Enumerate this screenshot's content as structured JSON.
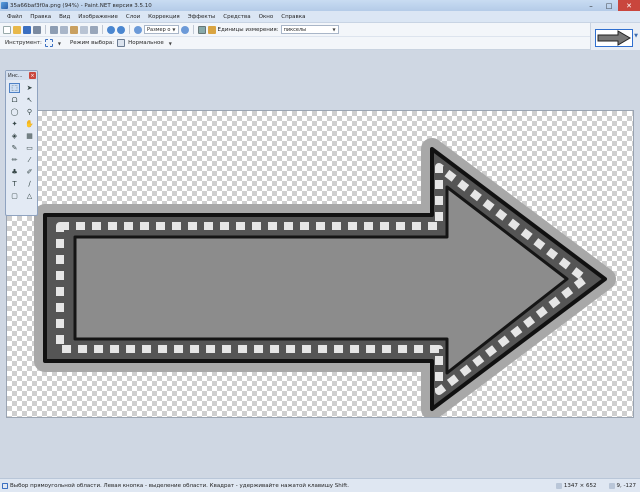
{
  "window": {
    "title": "35a66baf3f0a.png (94%) - Paint.NET версия 3.5.10",
    "minimize": "–",
    "maximize": "□",
    "close": "✕"
  },
  "menu": [
    "Файл",
    "Правка",
    "Вид",
    "Изображение",
    "Слои",
    "Коррекция",
    "Эффекты",
    "Средства",
    "Окно",
    "Справка"
  ],
  "toolbar": {
    "size_dropdown": "Размер о",
    "units_label": "Единицы измерения:",
    "units_value": "пикселы"
  },
  "toolbar2": {
    "instrument_label": "Инструмент:",
    "selection_mode_label": "Режим выбора:",
    "selection_mode_value": "Нормальное"
  },
  "tools": {
    "title": "Инс...",
    "close": "×"
  },
  "status": {
    "hint": "Выбор прямоугольной области. Левая кнопка - выделение области. Квадрат - удерживайте нажатой клавишу Shift.",
    "size": "1347 × 652",
    "position": "9, -127"
  }
}
